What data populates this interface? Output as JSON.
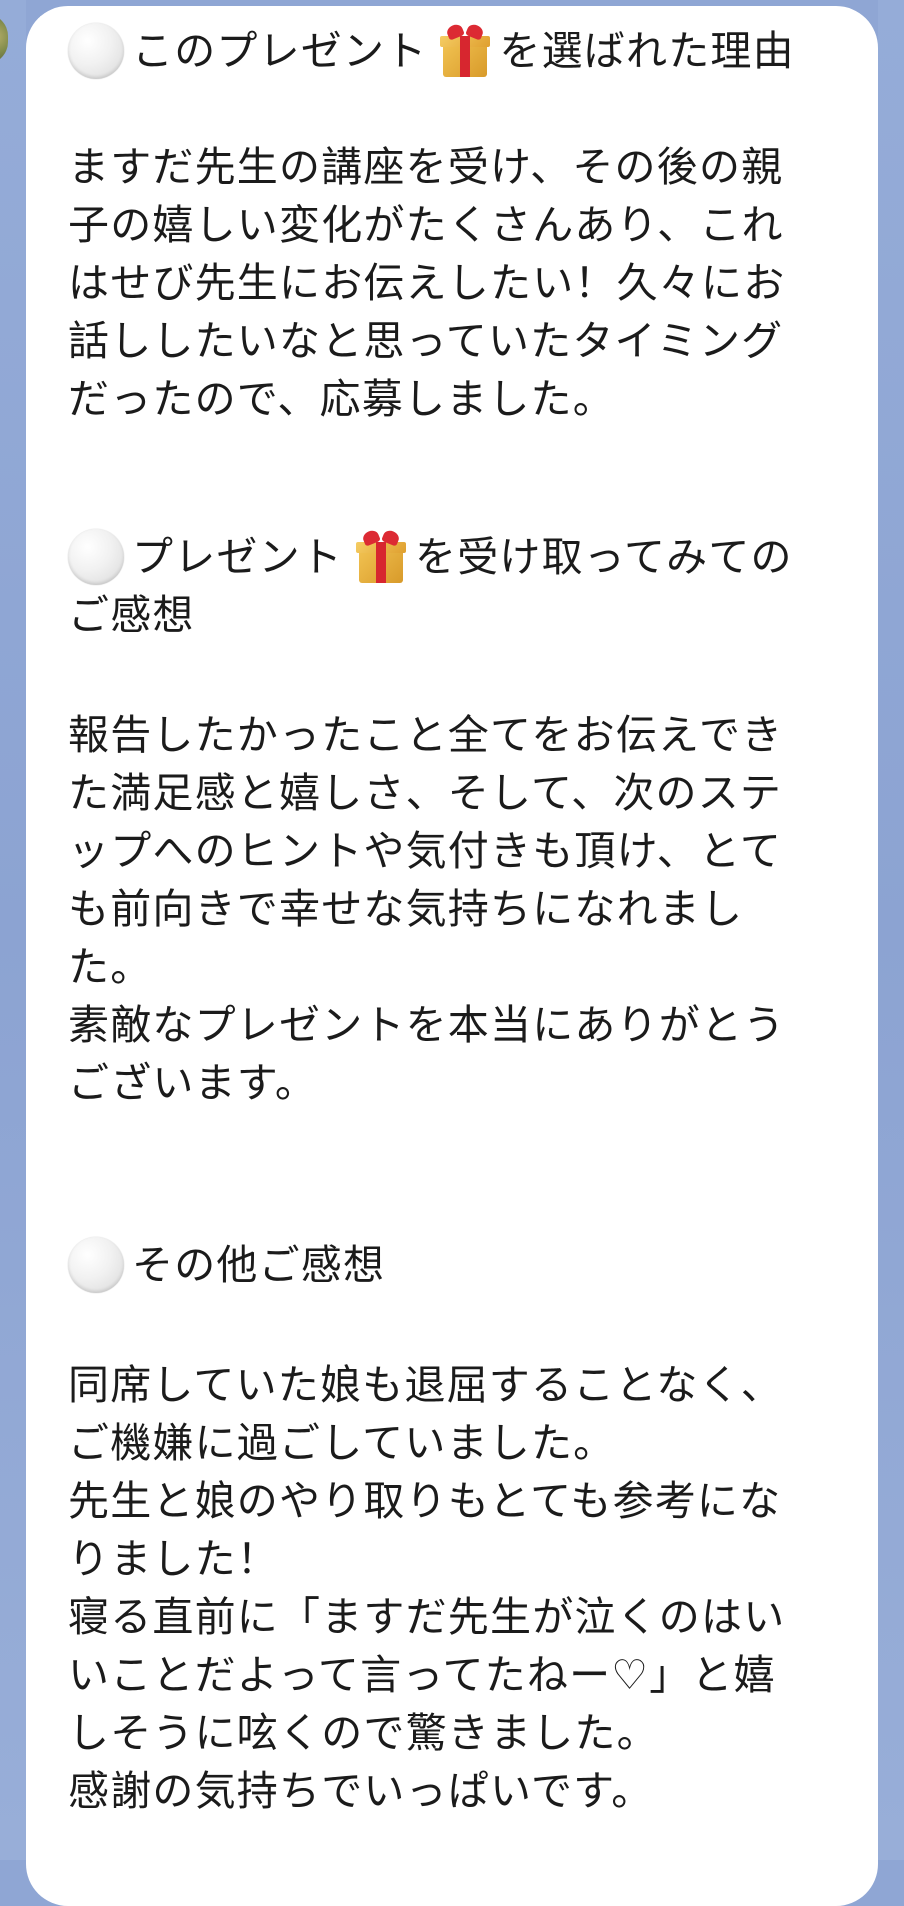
{
  "message": {
    "section1": {
      "heading": "このプレゼント🎁を選ばれた理由",
      "heading_before": "このプレゼント",
      "heading_after": "を選ばれた理由",
      "body_lines": [
        "ますだ先生の講座を受け、その後の親",
        "子の嬉しい変化がたくさんあり、これ",
        "はせび先生にお伝えしたい！久々にお",
        "話ししたいなと思っていたタイミング",
        "だったので、応募しました。"
      ]
    },
    "section2": {
      "heading": "プレゼント🎁を受け取ってみてのご感想",
      "heading_before": "プレゼント",
      "heading_after": "を受け取ってみての",
      "heading_line2": "ご感想",
      "body_lines": [
        "報告したかったこと全てをお伝えでき",
        "た満足感と嬉しさ、そして、次のステ",
        "ップへのヒントや気付きも頂け、とて",
        "も前向きで幸せな気持ちになれまし",
        "た。",
        "素敵なプレゼントを本当にありがとう",
        "ございます。"
      ]
    },
    "section3": {
      "heading": "その他ご感想",
      "body_lines": [
        "同席していた娘も退屈することなく、",
        "ご機嫌に過ごしていました。",
        "先生と娘のやり取りもとても参考にな",
        "りました！",
        "寝る直前に「ますだ先生が泣くのはい",
        "いことだよって言ってたねー♡」と嬉",
        "しそうに呟くので驚きました。",
        "感謝の気持ちでいっぱいです。"
      ]
    }
  },
  "icons": {
    "bullet": "white-circle-icon",
    "gift": "gift-icon"
  },
  "colors": {
    "background": "#8fa6d4",
    "bubble": "#ffffff",
    "text": "#1b1b1b"
  }
}
